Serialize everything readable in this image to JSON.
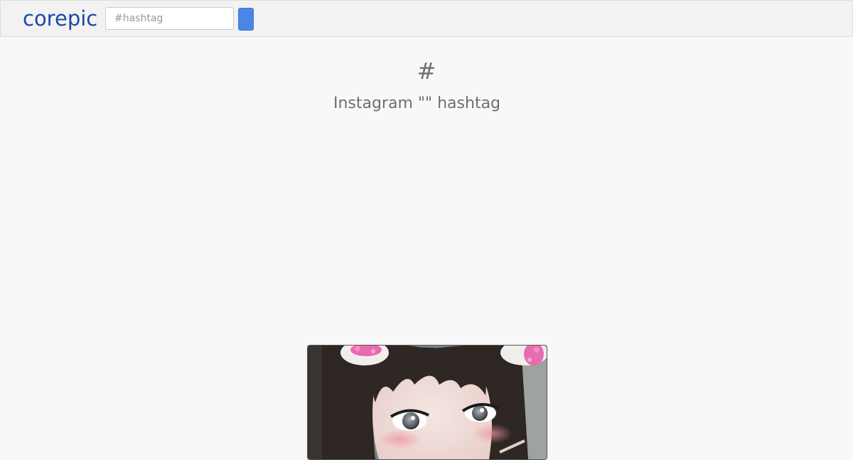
{
  "navbar": {
    "brand": "corepic",
    "search": {
      "placeholder": "#hashtag",
      "value": ""
    }
  },
  "header": {
    "title": "#",
    "subtitle": "Instagram \"\" hashtag"
  },
  "photo": {
    "description_icon": "photo"
  }
}
